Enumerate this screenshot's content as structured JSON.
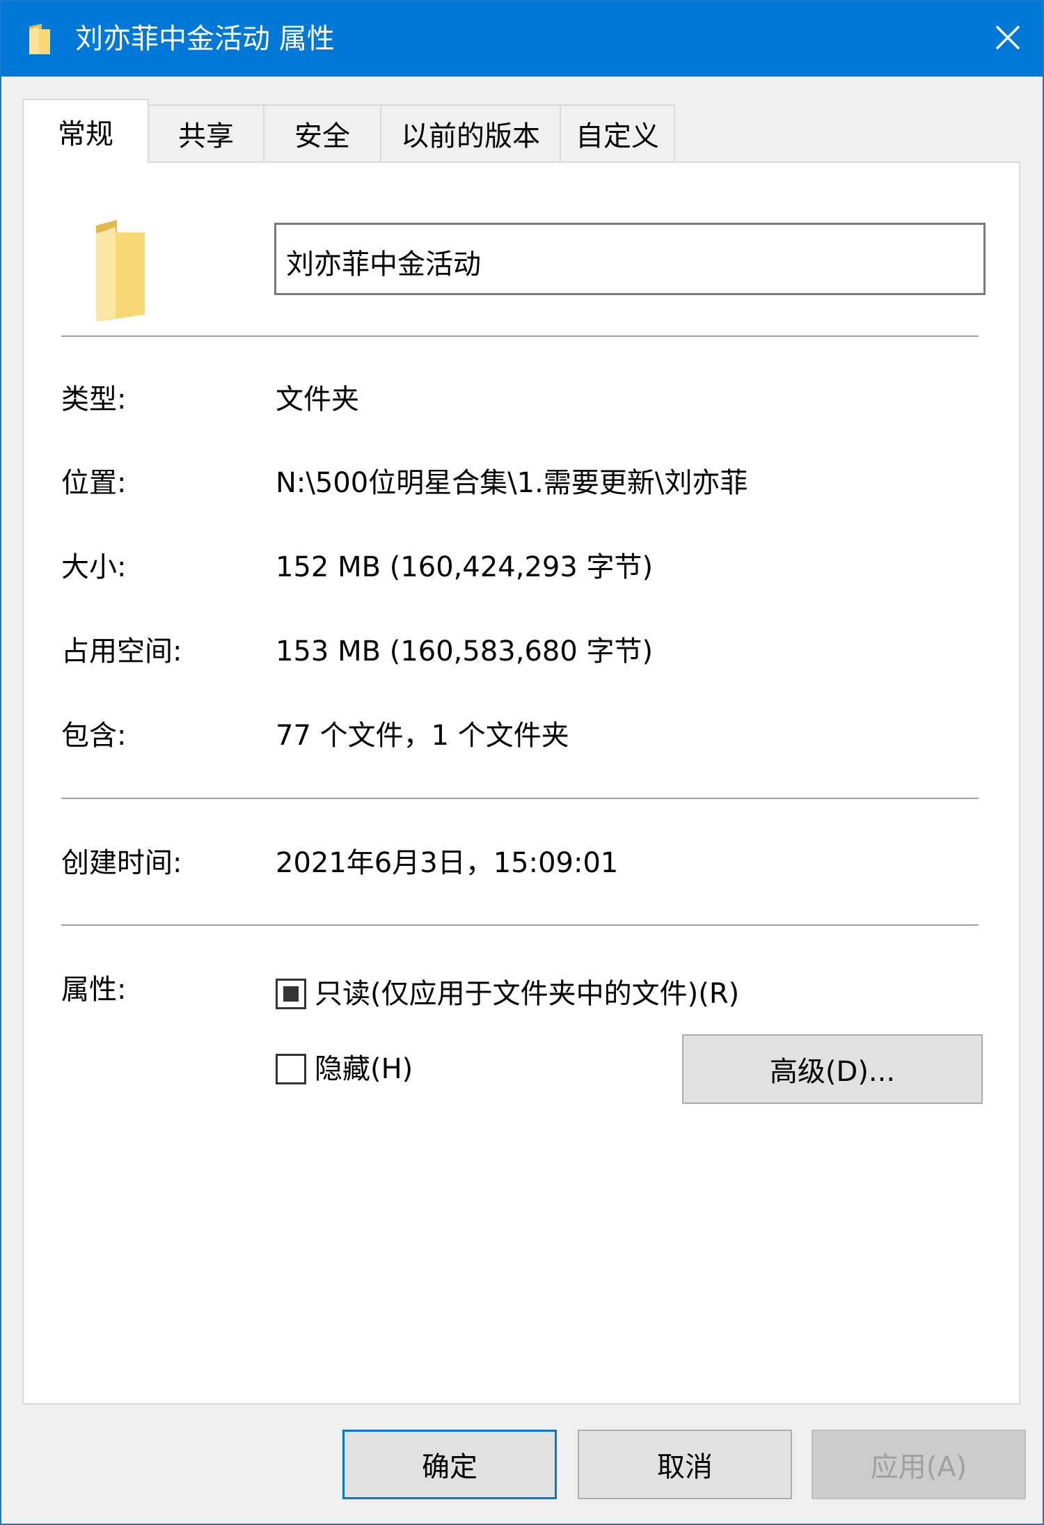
{
  "window": {
    "title": "刘亦菲中金活动 属性",
    "title_icon": "folder-icon",
    "close_icon": "close-icon"
  },
  "tabs": [
    {
      "label": "常规",
      "active": true
    },
    {
      "label": "共享",
      "active": false
    },
    {
      "label": "安全",
      "active": false
    },
    {
      "label": "以前的版本",
      "active": false
    },
    {
      "label": "自定义",
      "active": false
    }
  ],
  "general": {
    "folder_icon": "folder-icon",
    "name_value": "刘亦菲中金活动",
    "type_label": "类型:",
    "type_value": "文件夹",
    "location_label": "位置:",
    "location_value": "N:\\500位明星合集\\1.需要更新\\刘亦菲",
    "size_label": "大小:",
    "size_value": "152 MB (160,424,293 字节)",
    "size_on_disk_label": "占用空间:",
    "size_on_disk_value": "153 MB (160,583,680 字节)",
    "contains_label": "包含:",
    "contains_value": "77 个文件，1 个文件夹",
    "created_label": "创建时间:",
    "created_value": "2021年6月3日，15:09:01",
    "attributes_label": "属性:",
    "readonly_label": "只读(仅应用于文件夹中的文件)(R)",
    "readonly_state": "indeterminate",
    "hidden_label": "隐藏(H)",
    "hidden_state": "unchecked",
    "advanced_button": "高级(D)..."
  },
  "footer": {
    "ok_button": "确定",
    "cancel_button": "取消",
    "apply_button": "应用(A)"
  },
  "colors": {
    "titlebar": "#0078d7",
    "folder": "#f8d775",
    "folder_dark": "#e4b84a"
  }
}
